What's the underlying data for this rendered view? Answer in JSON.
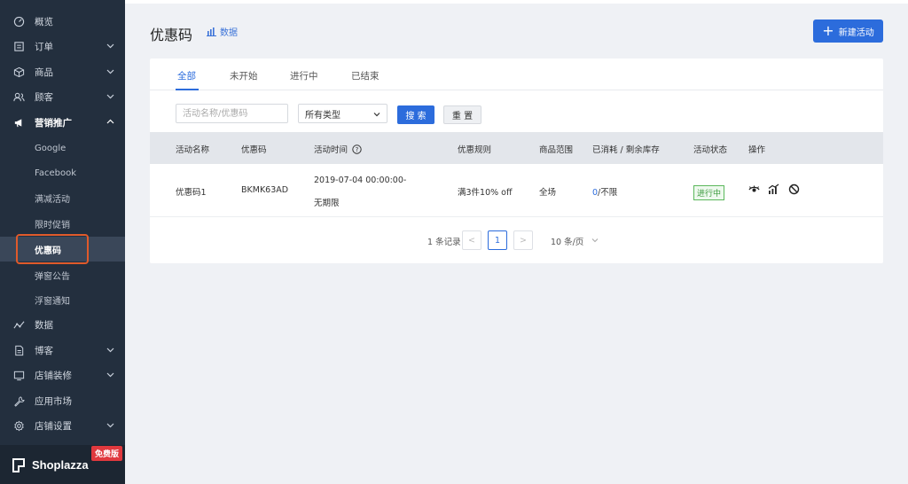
{
  "sidebar": {
    "items": [
      {
        "label": "概览",
        "icon": "dashboard-icon"
      },
      {
        "label": "订单",
        "icon": "orders-icon"
      },
      {
        "label": "商品",
        "icon": "product-box-icon"
      },
      {
        "label": "顾客",
        "icon": "customers-icon"
      },
      {
        "label": "营销推广",
        "icon": "megaphone-icon"
      },
      {
        "label": "Google"
      },
      {
        "label": "Facebook"
      },
      {
        "label": "满减活动"
      },
      {
        "label": "限时促销"
      },
      {
        "label": "优惠码"
      },
      {
        "label": "弹窗公告"
      },
      {
        "label": "浮窗通知"
      },
      {
        "label": "数据",
        "icon": "analytics-icon"
      },
      {
        "label": "博客",
        "icon": "blog-icon"
      },
      {
        "label": "店铺装修",
        "icon": "store-design-icon"
      },
      {
        "label": "应用市场",
        "icon": "apps-icon"
      },
      {
        "label": "店铺设置",
        "icon": "settings-gear-icon"
      }
    ],
    "brand": "Shoplazza",
    "plan_badge": "免费版"
  },
  "header": {
    "title": "优惠码",
    "data_link": "数据",
    "new_button": "新建活动"
  },
  "tabs": [
    "全部",
    "未开始",
    "进行中",
    "已结束"
  ],
  "filters": {
    "search_placeholder": "活动名称/优惠码",
    "type_select": "所有类型",
    "search_button": "搜 索",
    "reset_button": "重 置"
  },
  "table": {
    "columns": [
      "活动名称",
      "优惠码",
      "活动时间",
      "优惠规则",
      "商品范围",
      "已消耗 / 剩余库存",
      "活动状态",
      "操作"
    ],
    "rows": [
      {
        "name": "优惠码1",
        "code": "BKMK63AD",
        "time_start": "2019-07-04 00:00:00-",
        "time_end": "无期限",
        "rule": "满3件10% off",
        "scope": "全场",
        "used": "0",
        "stock": "/不限",
        "status": "进行中"
      }
    ]
  },
  "pagination": {
    "total": "1 条记录",
    "prev": "<",
    "current": "1",
    "next": ">",
    "page_size": "10 条/页"
  },
  "colors": {
    "sidebar_bg": "#232f3e",
    "primary": "#2c6cdc",
    "status_green": "#3a9a3c",
    "highlight": "#e05a2b"
  }
}
